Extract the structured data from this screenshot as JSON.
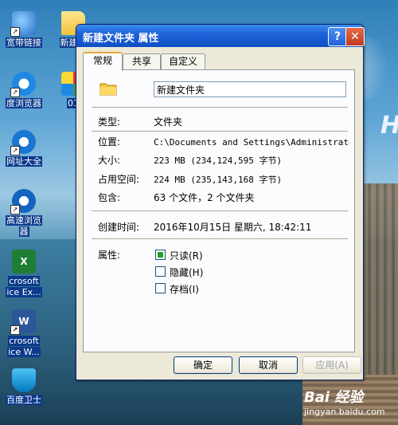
{
  "desktop": {
    "icons": [
      {
        "label": "宽带链接",
        "icon": "network-icon"
      },
      {
        "label": "新建文",
        "icon": "folder-icon"
      },
      {
        "label": "度浏览器",
        "icon": "browser-icon"
      },
      {
        "label": "01",
        "icon": "image-file-icon"
      },
      {
        "label": "网址大全",
        "icon": "ie-icon"
      },
      {
        "label": "高速浏览",
        "label2": "器",
        "icon": "browser-icon"
      },
      {
        "label": "crosoft",
        "label2": "ice Ex...",
        "icon": "excel-icon"
      },
      {
        "label": "crosoft",
        "label2": "ice W...",
        "icon": "word-icon"
      },
      {
        "label": "百度卫士",
        "icon": "shield-icon"
      }
    ],
    "watermark": {
      "brand": "Bai 经验",
      "url": "jingyan.baidu.com"
    }
  },
  "window": {
    "title": "新建文件夹 属性",
    "help_label": "?",
    "close_label": "✕",
    "tabs": [
      {
        "label": "常规",
        "active": true
      },
      {
        "label": "共享",
        "active": false
      },
      {
        "label": "自定义",
        "active": false
      }
    ],
    "name_value": "新建文件夹",
    "fields": {
      "type_label": "类型:",
      "type_value": "文件夹",
      "location_label": "位置:",
      "location_value": "C:\\Documents and Settings\\Administrator\\桌",
      "size_label": "大小:",
      "size_value": "223 MB (234,124,595 字节)",
      "disk_label": "占用空间:",
      "disk_value": "224 MB (235,143,168 字节)",
      "contains_label": "包含:",
      "contains_value": "63 个文件，2 个文件夹",
      "created_label": "创建时间:",
      "created_value": "2016年10月15日 星期六, 18:42:11",
      "attributes_label": "属性:"
    },
    "attributes": [
      {
        "label": "只读(R)",
        "checked": true
      },
      {
        "label": "隐藏(H)",
        "checked": false
      },
      {
        "label": "存档(I)",
        "checked": false
      }
    ],
    "buttons": {
      "ok": "确定",
      "cancel": "取消",
      "apply": "应用(A)"
    }
  }
}
